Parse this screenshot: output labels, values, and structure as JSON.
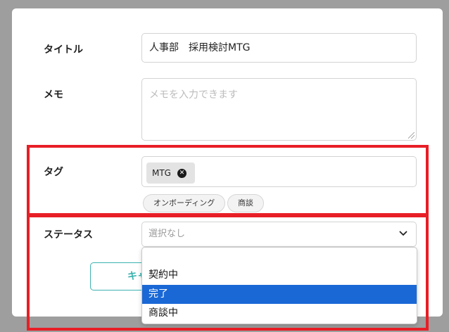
{
  "form": {
    "title_label": "タイトル",
    "title_value": "人事部　採用検討MTG",
    "memo_label": "メモ",
    "memo_placeholder": "メモを入力できます",
    "tag_label": "タグ",
    "tags": [
      {
        "label": "MTG",
        "remove_icon": "close-circle-icon"
      }
    ],
    "tag_suggestions": [
      "オンボーディング",
      "商談"
    ],
    "status_label": "ステータス",
    "status_value": "選択なし",
    "status_options": [
      "",
      "契約中",
      "完了",
      "商談中"
    ],
    "status_highlighted": "完了",
    "cancel_label": "キャ"
  },
  "colors": {
    "overlay": "#9e9e9e",
    "highlight_frame": "#e81e26",
    "selected_option": "#1a68d6",
    "cancel_accent": "#3bb3b0"
  }
}
